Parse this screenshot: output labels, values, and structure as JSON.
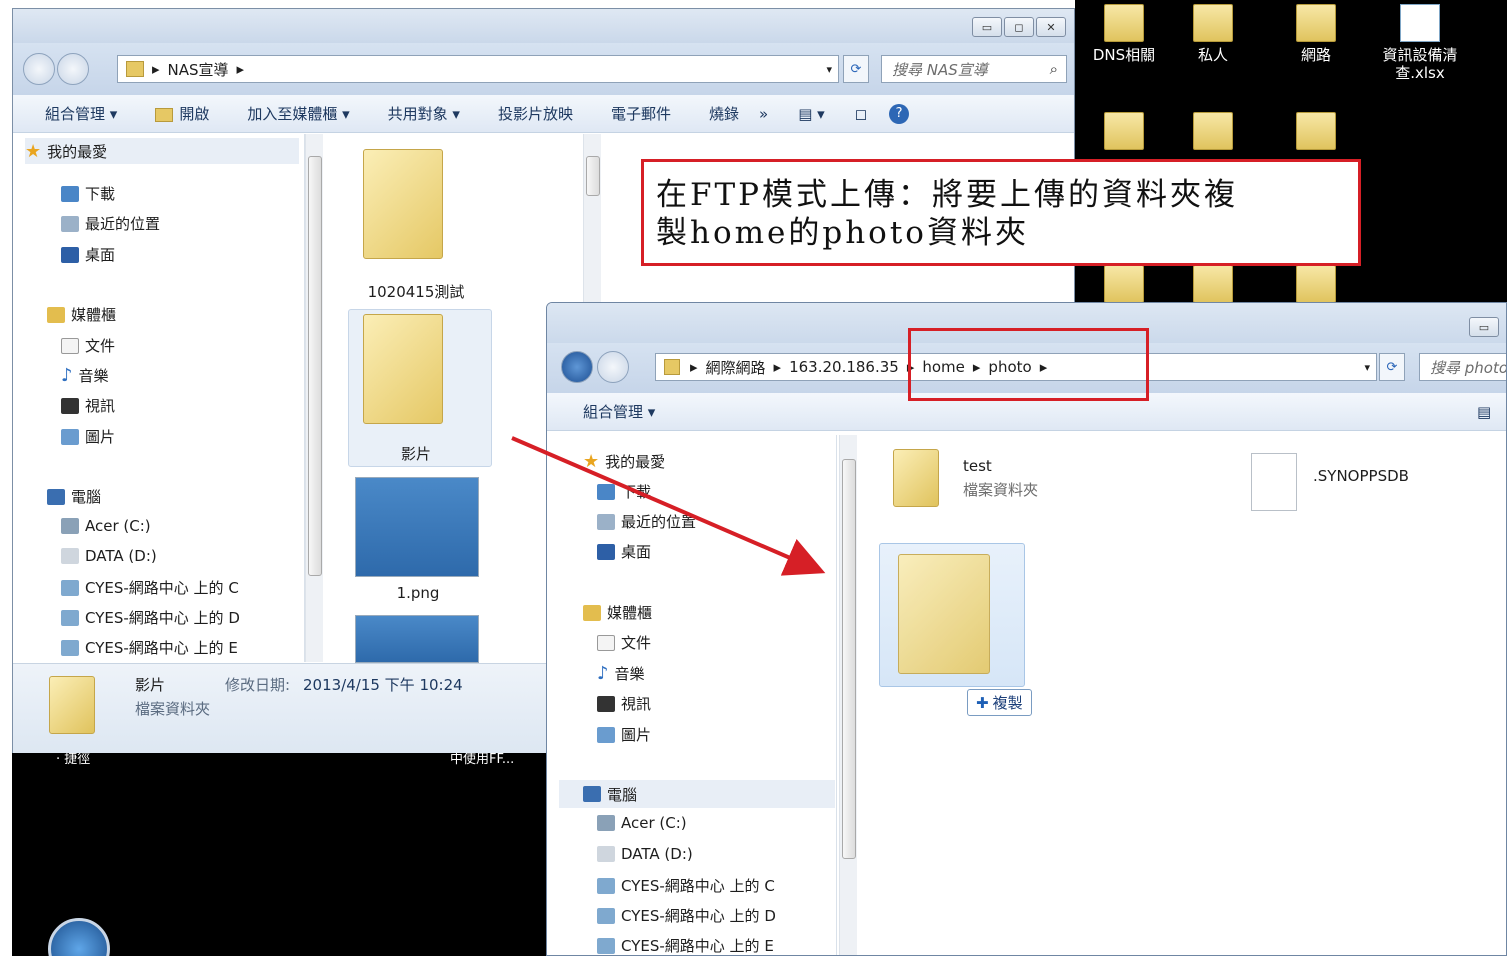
{
  "desktop": {
    "icons": [
      {
        "label": "DNS相關",
        "icon": "folder-icon"
      },
      {
        "label": "私人",
        "icon": "folder-icon"
      },
      {
        "label": "網路",
        "icon": "folder-icon"
      },
      {
        "label": "資訊設備清查.xlsx",
        "icon": "excel-file-icon"
      }
    ],
    "bottom_left_text": "‧ 捷徑",
    "bottom_right_text": "中使用FF..."
  },
  "window1": {
    "breadcrumb": [
      "NAS宣導"
    ],
    "search_placeholder": "搜尋 NAS宣導",
    "toolbar": [
      "組合管理 ▾",
      "開啟",
      "加入至媒體櫃 ▾",
      "共用對象 ▾",
      "投影片放映",
      "電子郵件",
      "燒錄",
      "»"
    ],
    "nav": {
      "favorites_header": "我的最愛",
      "favorites": [
        "下載",
        "最近的位置",
        "桌面"
      ],
      "libraries_header": "媒體櫃",
      "libraries": [
        "文件",
        "音樂",
        "視訊",
        "圖片"
      ],
      "computer_header": "電腦",
      "drives": [
        "Acer (C:)",
        "DATA (D:)",
        "CYES-網路中心 上的 C",
        "CYES-網路中心 上的 D",
        "CYES-網路中心 上的 E"
      ]
    },
    "files": [
      {
        "name": "1020415測試",
        "type": "folder"
      },
      {
        "name": "影片",
        "type": "folder"
      },
      {
        "name": "1.png",
        "type": "image"
      }
    ],
    "details": {
      "name": "影片",
      "type": "檔案資料夾",
      "modified_label": "修改日期:",
      "modified_value": "2013/4/15 下午 10:24"
    }
  },
  "window2": {
    "breadcrumb": [
      "網際網路",
      "163.20.186.35",
      "home",
      "photo"
    ],
    "search_placeholder": "搜尋 photo",
    "toolbar": [
      "組合管理 ▾"
    ],
    "nav": {
      "favorites_header": "我的最愛",
      "favorites": [
        "下載",
        "最近的位置",
        "桌面"
      ],
      "libraries_header": "媒體櫃",
      "libraries": [
        "文件",
        "音樂",
        "視訊",
        "圖片"
      ],
      "computer_header": "電腦",
      "drives": [
        "Acer (C:)",
        "DATA (D:)",
        "CYES-網路中心 上的 C",
        "CYES-網路中心 上的 D",
        "CYES-網路中心 上的 E"
      ]
    },
    "files": [
      {
        "name": "test",
        "subtitle": "檔案資料夾",
        "type": "folder"
      },
      {
        "name": ".SYNOPPSDB",
        "subtitle": "",
        "type": "file"
      }
    ],
    "copy_badge": "複製"
  },
  "annotation": {
    "callout_line1": "在FTP模式上傳：將要上傳的資料夾複",
    "callout_line2": "製home的photo資料夾",
    "color": "#d61f26"
  }
}
